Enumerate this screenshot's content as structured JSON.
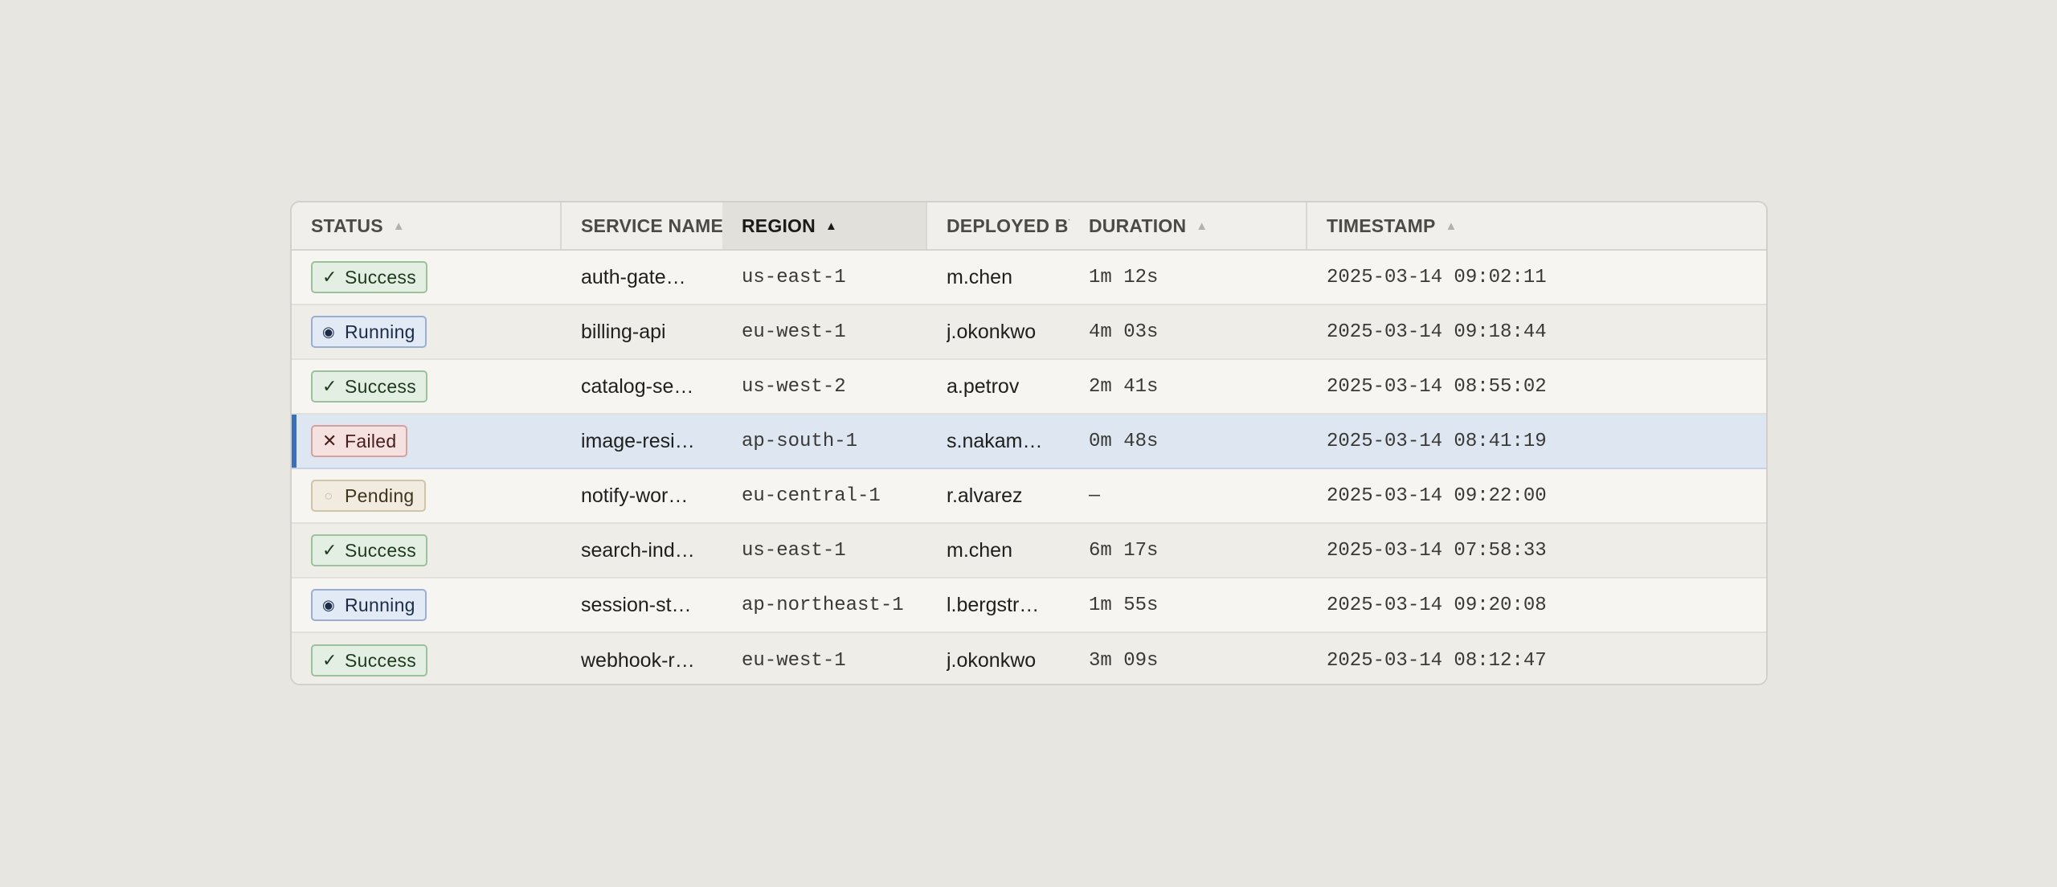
{
  "colors": {
    "success": "#e3efe3",
    "running": "#e2eaf5",
    "failed": "#f6e1e1",
    "pending": "#f2ece0",
    "selection_accent": "#3b6fb6"
  },
  "columns": [
    {
      "key": "status",
      "label": "STATUS",
      "sort_icon": "sort-up-icon",
      "sort_glyph": "▲",
      "sorted": false
    },
    {
      "key": "service",
      "label": "SERVICE NAME",
      "sort_icon": "",
      "sort_glyph": "",
      "sorted": false
    },
    {
      "key": "region",
      "label": "REGION",
      "sort_icon": "sort-up-icon",
      "sort_glyph": "▲",
      "sorted": true
    },
    {
      "key": "deployed_by",
      "label": "DEPLOYED BY",
      "sort_icon": "sort-up-icon",
      "sort_glyph": "▲",
      "sorted": false
    },
    {
      "key": "duration",
      "label": "DURATION",
      "sort_icon": "sort-up-icon",
      "sort_glyph": "▲",
      "sorted": false
    },
    {
      "key": "timestamp",
      "label": "TIMESTAMP",
      "sort_icon": "sort-up-icon",
      "sort_glyph": "▲",
      "sorted": false
    }
  ],
  "rows": [
    {
      "status": "Success",
      "status_kind": "success",
      "status_icon": "check-icon",
      "status_glyph": "✓",
      "service": "auth-gate…",
      "region": "us-east-1",
      "deployed_by": "m.chen",
      "duration": "1m 12s",
      "timestamp": "2025-03-14 09:02:11",
      "selected": false
    },
    {
      "status": "Running",
      "status_kind": "running",
      "status_icon": "radio-dot-icon",
      "status_glyph": "◉",
      "service": "billing-api",
      "region": "eu-west-1",
      "deployed_by": "j.okonkwo",
      "duration": "4m 03s",
      "timestamp": "2025-03-14 09:18:44",
      "selected": false
    },
    {
      "status": "Success",
      "status_kind": "success",
      "status_icon": "check-icon",
      "status_glyph": "✓",
      "service": "catalog-se…",
      "region": "us-west-2",
      "deployed_by": "a.petrov",
      "duration": "2m 41s",
      "timestamp": "2025-03-14 08:55:02",
      "selected": false
    },
    {
      "status": "Failed",
      "status_kind": "failed",
      "status_icon": "x-icon",
      "status_glyph": "✕",
      "service": "image-resi…",
      "region": "ap-south-1",
      "deployed_by": "s.nakam…",
      "duration": "0m 48s",
      "timestamp": "2025-03-14 08:41:19",
      "selected": true
    },
    {
      "status": "Pending",
      "status_kind": "pending",
      "status_icon": "circle-outline-icon",
      "status_glyph": "○",
      "service": "notify-wor…",
      "region": "eu-central-1",
      "deployed_by": "r.alvarez",
      "duration": "—",
      "timestamp": "2025-03-14 09:22:00",
      "selected": false
    },
    {
      "status": "Success",
      "status_kind": "success",
      "status_icon": "check-icon",
      "status_glyph": "✓",
      "service": "search-ind…",
      "region": "us-east-1",
      "deployed_by": "m.chen",
      "duration": "6m 17s",
      "timestamp": "2025-03-14 07:58:33",
      "selected": false
    },
    {
      "status": "Running",
      "status_kind": "running",
      "status_icon": "radio-dot-icon",
      "status_glyph": "◉",
      "service": "session-st…",
      "region": "ap-northeast-1",
      "deployed_by": "l.bergstr…",
      "duration": "1m 55s",
      "timestamp": "2025-03-14 09:20:08",
      "selected": false
    },
    {
      "status": "Success",
      "status_kind": "success",
      "status_icon": "check-icon",
      "status_glyph": "✓",
      "service": "webhook-r…",
      "region": "eu-west-1",
      "deployed_by": "j.okonkwo",
      "duration": "3m 09s",
      "timestamp": "2025-03-14 08:12:47",
      "selected": false
    }
  ]
}
